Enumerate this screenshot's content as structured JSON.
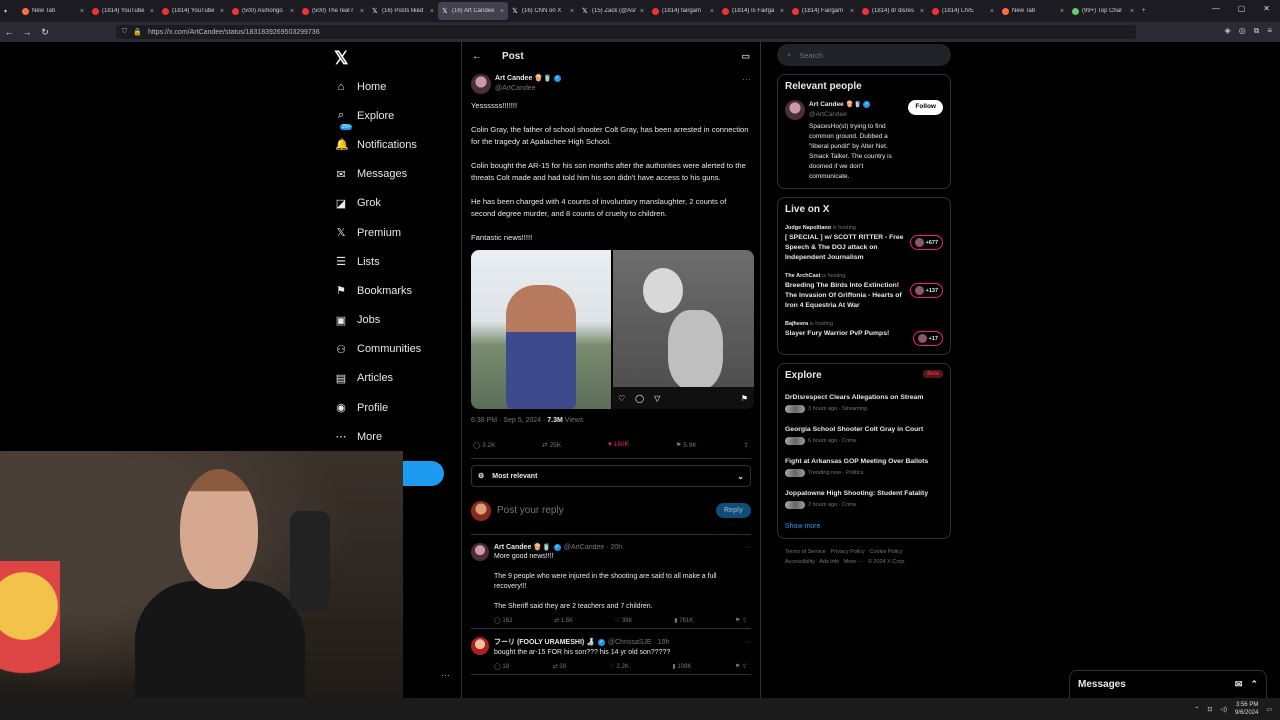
{
  "browser": {
    "tabs": [
      {
        "title": "New Tab",
        "fav": "fox"
      },
      {
        "title": "(1814) YouTube",
        "fav": "yt"
      },
      {
        "title": "(1814) YouTube",
        "fav": "yt"
      },
      {
        "title": "(500) Asmongo",
        "fav": "yt"
      },
      {
        "title": "(500) The real r",
        "fav": "yt"
      },
      {
        "title": "(16) Posts liked",
        "fav": "x"
      },
      {
        "title": "(16) Art Candee",
        "fav": "x",
        "active": true
      },
      {
        "title": "(16) CNN on X",
        "fav": "x"
      },
      {
        "title": "(15) Zack (@Asr",
        "fav": "x"
      },
      {
        "title": "(1814) fairgam",
        "fav": "yt"
      },
      {
        "title": "(1814) Is Fairga",
        "fav": "yt"
      },
      {
        "title": "(1814) Fairgam",
        "fav": "yt"
      },
      {
        "title": "(1814) dr disres",
        "fav": "yt"
      },
      {
        "title": "(1814) LIVE",
        "fav": "yt"
      },
      {
        "title": "New Tab",
        "fav": "fox"
      },
      {
        "title": "(99+) Top Char",
        "fav": "tw"
      }
    ],
    "url": "https://x.com/ArtCandee/status/1831839269503299736"
  },
  "sidebar": {
    "logo": "𝕏",
    "items": [
      {
        "icon": "⌂",
        "label": "Home"
      },
      {
        "icon": "⌕",
        "label": "Explore"
      },
      {
        "icon": "🔔",
        "label": "Notifications",
        "badge": "20+"
      },
      {
        "icon": "✉",
        "label": "Messages"
      },
      {
        "icon": "◪",
        "label": "Grok"
      },
      {
        "icon": "𝕏",
        "label": "Premium"
      },
      {
        "icon": "☰",
        "label": "Lists"
      },
      {
        "icon": "⚑",
        "label": "Bookmarks"
      },
      {
        "icon": "▣",
        "label": "Jobs"
      },
      {
        "icon": "⚇",
        "label": "Communities"
      },
      {
        "icon": "▤",
        "label": "Articles"
      },
      {
        "icon": "◉",
        "label": "Profile"
      },
      {
        "icon": "⋯",
        "label": "More"
      }
    ],
    "more_dots": "⋯"
  },
  "main": {
    "header_title": "Post",
    "post": {
      "name": "Art Candee 🍿🥤",
      "handle": "@ArtCandee",
      "text": "Yessssss!!!!!!!\n\nColin Gray, the father of school shooter Colt Gray, has been arrested in connection for the tragedy at Apalachee High School.\n\nColin bought the AR-15 for his son months after the authorities were alerted to the threats Colt made and had told him his son didn't have access to his guns.\n\nHe has been charged with 4 counts of involuntary manslaughter, 2 counts of second degree murder, and 8 counts of cruelty to children.\n\nFantastic news!!!!!",
      "timestamp": "6:38 PM · Sep 5, 2024 · ",
      "views": "7.3M",
      "views_label": " Views",
      "replies": "3.2K",
      "reposts": "25K",
      "likes": "180K",
      "bookmarks": "5.9K"
    },
    "sort_label": "Most relevant",
    "reply_placeholder": "Post your reply",
    "reply_button": "Reply",
    "replies": [
      {
        "name": "Art Candee 🍿🥤",
        "handle": "@ArtCandee · 20h",
        "text": "More good news!!!!\n\nThe 9 people who were injured in the shooting are said to all make a full recovery!!!\n\nThe Sheriff said they are 2 teachers and 7 children.",
        "replies": "162",
        "reposts": "1.5K",
        "likes": "38K",
        "views": "781K"
      },
      {
        "name": "フーリ (FOOLY URAMESHI) 🍶",
        "handle": "@ChrissaSJE · 19h",
        "text": "bought the ar-15 FOR his son??? his 14 yr old son?????",
        "replies": "18",
        "reposts": "39",
        "likes": "2.2K",
        "views": "108K"
      }
    ]
  },
  "right": {
    "search_placeholder": "Search",
    "relevant_title": "Relevant people",
    "relevant_person": {
      "name": "Art Candee 🍿🥤",
      "handle": "@ArtCandee",
      "bio": "SpacesHo(st) trying to find common ground. Dubbed a \"liberal pundit\" by Alter Net. Smack Talker. The country is doomed if we don't communicate.",
      "follow": "Follow"
    },
    "live_title": "Live on X",
    "live": [
      {
        "host": "Judge Napolitano",
        "status": "is hosting",
        "title": "[ SPECIAL ] w/ SCOTT RITTER - Free Speech & The DOJ attack on Independent Journalism",
        "count": "+677"
      },
      {
        "host": "The ArchCast",
        "status": "is hosting",
        "title": "Breeding The Birds Into Extinction! The Invasion Of Griffonia - Hearts of Iron 4 Equestria At War",
        "count": "+137"
      },
      {
        "host": "Bajheera",
        "status": "is hosting",
        "title": "Slayer Fury Warrior PvP Pumps!",
        "count": "+17"
      }
    ],
    "explore_title": "Explore",
    "explore_badge": "Beta",
    "explore": [
      {
        "title": "DrDisrespect Clears Allegations on Stream",
        "meta": "3 hours ago · Streaming"
      },
      {
        "title": "Georgia School Shooter Colt Gray in Court",
        "meta": "6 hours ago · Crime"
      },
      {
        "title": "Fight at Arkansas GOP Meeting Over Ballots",
        "meta": "Trending now · Politics"
      },
      {
        "title": "Joppatowne High Shooting: Student Fatality",
        "meta": "2 hours ago · Crime"
      }
    ],
    "show_more": "Show more",
    "footer": "Terms of Service   Privacy Policy   Cookie Policy\nAccessibility   Ads info   More ···   © 2024 X Corp."
  },
  "messages_dock": "Messages",
  "taskbar": {
    "time": "3:56 PM",
    "date": "9/6/2024"
  }
}
